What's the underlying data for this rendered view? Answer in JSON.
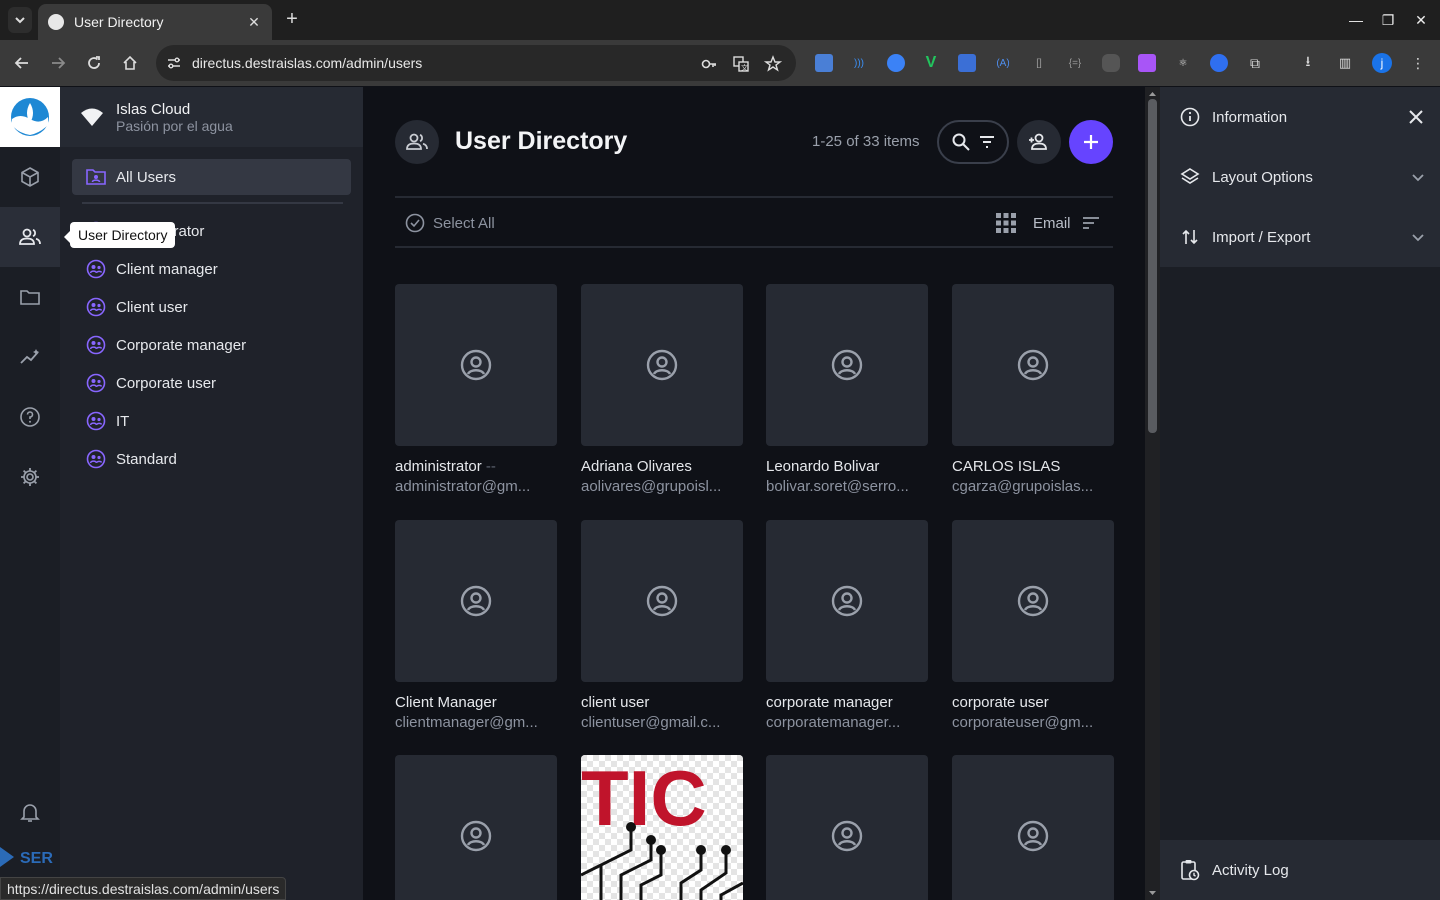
{
  "browser": {
    "tab_title": "User Directory",
    "url": "directus.destraislas.com/admin/users",
    "status_url": "https://directus.destraislas.com/admin/users",
    "profile_initial": "j"
  },
  "project": {
    "name": "Islas Cloud",
    "subtitle": "Pasión por el agua"
  },
  "modules": [
    "content",
    "users",
    "files",
    "insights",
    "help",
    "settings"
  ],
  "tooltip": "User Directory",
  "nav": {
    "items": [
      {
        "label": "All Users",
        "icon": "folder-person-icon",
        "active": true
      },
      {
        "label": "Administrator",
        "icon": "role-icon"
      },
      {
        "label": "Client manager",
        "icon": "role-icon"
      },
      {
        "label": "Client user",
        "icon": "role-icon"
      },
      {
        "label": "Corporate manager",
        "icon": "role-icon"
      },
      {
        "label": "Corporate user",
        "icon": "role-icon"
      },
      {
        "label": "IT",
        "icon": "role-icon"
      },
      {
        "label": "Standard",
        "icon": "role-icon"
      }
    ]
  },
  "header": {
    "title": "User Directory",
    "count": "1-25 of 33 items"
  },
  "toolbar": {
    "select_all": "Select All",
    "sort_field": "Email"
  },
  "users": [
    {
      "name": "administrator",
      "suffix": "--",
      "email": "administrator@gm..."
    },
    {
      "name": "Adriana Olivares",
      "email": "aolivares@grupoisl..."
    },
    {
      "name": "Leonardo Bolivar",
      "email": "bolivar.soret@serro..."
    },
    {
      "name": "CARLOS ISLAS",
      "email": "cgarza@grupoislas..."
    },
    {
      "name": "Client Manager",
      "email": "clientmanager@gm..."
    },
    {
      "name": "client user",
      "email": "clientuser@gmail.c..."
    },
    {
      "name": "corporate manager",
      "email": "corporatemanager..."
    },
    {
      "name": "corporate user",
      "email": "corporateuser@gm..."
    },
    {
      "name": "",
      "email": ""
    },
    {
      "name": "",
      "email": "",
      "avatar_text": "TIC"
    },
    {
      "name": "",
      "email": ""
    },
    {
      "name": "",
      "email": ""
    }
  ],
  "sidebar_right": {
    "information": "Information",
    "layout_options": "Layout Options",
    "import_export": "Import / Export",
    "activity_log": "Activity Log"
  },
  "colors": {
    "accent": "#6644ff",
    "role_icon": "#8866ff"
  }
}
